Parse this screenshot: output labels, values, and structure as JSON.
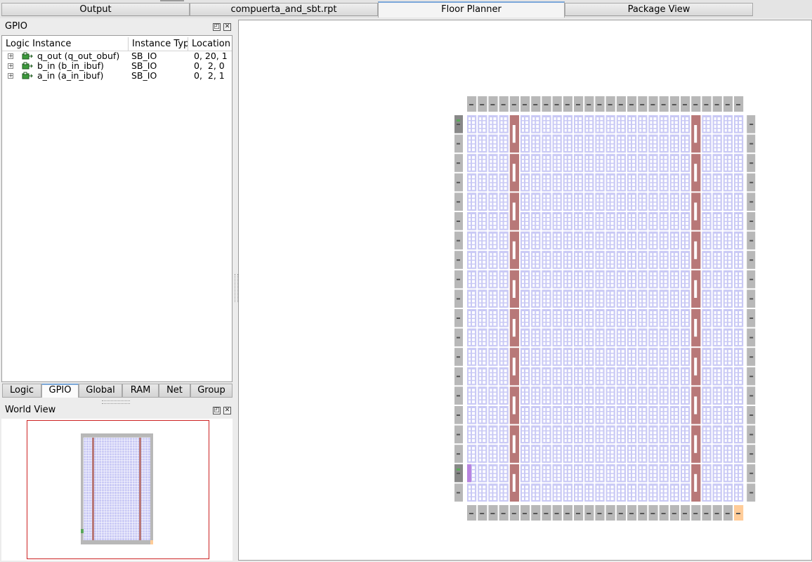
{
  "tabs": [
    {
      "label": "Output"
    },
    {
      "label": "compuerta_and_sbt.rpt"
    },
    {
      "label": "Floor Planner",
      "active": true
    },
    {
      "label": "Package View"
    }
  ],
  "gpio_panel": {
    "title": "GPIO",
    "columns": [
      "Logic Instance",
      "Instance Typ",
      "Location"
    ],
    "rows": [
      {
        "instance": "q_out (q_out_obuf)",
        "type": "SB_IO",
        "location": "0, 20, 1"
      },
      {
        "instance": "b_in (b_in_ibuf)",
        "type": "SB_IO",
        "location": "0,  2, 0"
      },
      {
        "instance": "a_in (a_in_ibuf)",
        "type": "SB_IO",
        "location": "0,  2, 1"
      }
    ],
    "bottom_tabs": [
      {
        "label": "Logic"
      },
      {
        "label": "GPIO",
        "active": true
      },
      {
        "label": "Global"
      },
      {
        "label": "RAM"
      },
      {
        "label": "Net"
      },
      {
        "label": "Group"
      }
    ]
  },
  "world_view": {
    "title": "World View"
  },
  "icons": {
    "restore": "restore-icon",
    "close": "close-icon",
    "expand": "expand-plus-icon",
    "io": "io-block-icon"
  },
  "colors": {
    "logic_tile": "#c9c9f5",
    "ram_column": "#b87878",
    "io_tile": "#b8b8b8",
    "used_io": "#5aa85a",
    "corner": "#ffcc99",
    "world_frame": "#cc2222",
    "active_tab": "#7aa7d9"
  }
}
